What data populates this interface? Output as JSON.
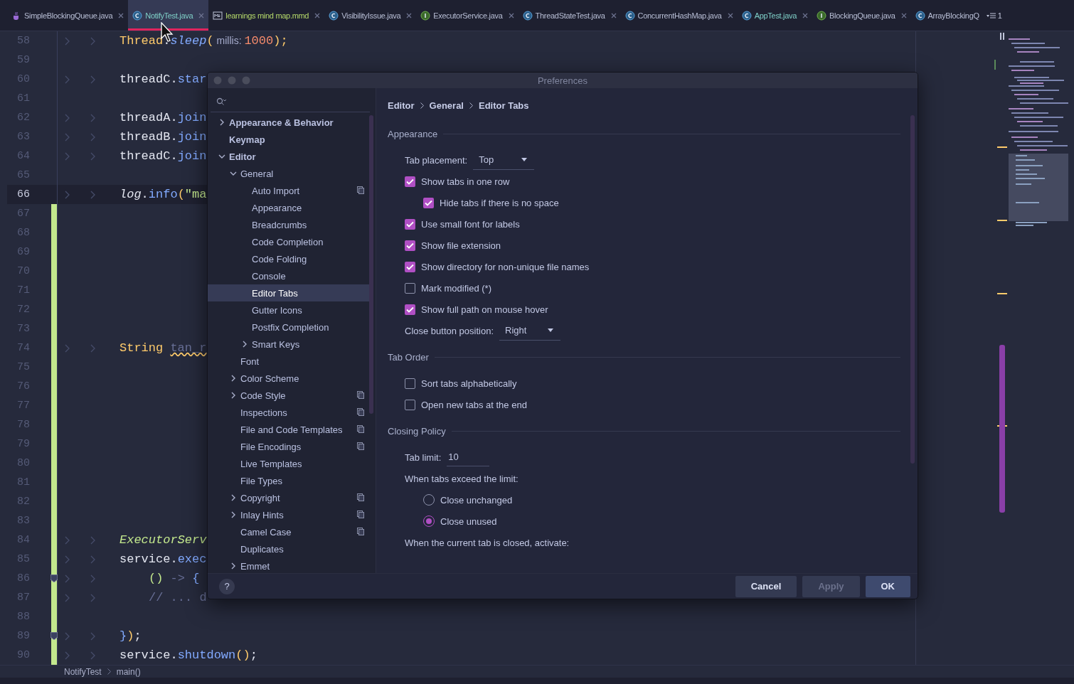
{
  "tabs": [
    {
      "label": "SimpleBlockingQueue.java",
      "kind": "java",
      "color": "#b9bfd6",
      "selected": false
    },
    {
      "label": "NotifyTest.java",
      "kind": "class",
      "color": "#7fd0c8",
      "selected": true
    },
    {
      "label": "learnings mind map.mmd",
      "kind": "markdown",
      "color": "#b5d96a",
      "selected": false
    },
    {
      "label": "VisibilityIssue.java",
      "kind": "class",
      "color": "#b9bfd6",
      "selected": false
    },
    {
      "label": "ExecutorService.java",
      "kind": "interface",
      "color": "#b9bfd6",
      "selected": false
    },
    {
      "label": "ThreadStateTest.java",
      "kind": "class",
      "color": "#b9bfd6",
      "selected": false
    },
    {
      "label": "ConcurrentHashMap.java",
      "kind": "class",
      "color": "#b9bfd6",
      "selected": false
    },
    {
      "label": "AppTest.java",
      "kind": "class",
      "color": "#7fd0c8",
      "selected": false
    },
    {
      "label": "BlockingQueue.java",
      "kind": "interface",
      "color": "#b9bfd6",
      "selected": false
    },
    {
      "label": "ArrayBlockingQ",
      "kind": "class",
      "color": "#b9bfd6",
      "selected": false
    }
  ],
  "tab_overflow_count": "1",
  "code_lines": [
    {
      "number": "58",
      "current": false,
      "changed": false,
      "fold_marker": false,
      "tokens": [
        {
          "text": "Thread",
          "kind": "class"
        },
        {
          "text": ".",
          "kind": "plain"
        },
        {
          "text": "sleep",
          "kind": "static"
        },
        {
          "text": "(",
          "kind": "paren"
        },
        {
          "text": " millis: ",
          "kind": "hint"
        },
        {
          "text": "1000",
          "kind": "number"
        },
        {
          "text": ");",
          "kind": "paren"
        }
      ]
    },
    {
      "number": "59",
      "current": false,
      "changed": false,
      "fold_marker": false
    },
    {
      "number": "60",
      "current": false,
      "changed": false,
      "fold_marker": false,
      "tokens": [
        {
          "text": "threadC",
          "kind": "plain"
        },
        {
          "text": ".",
          "kind": "plain"
        },
        {
          "text": "star",
          "kind": "method"
        }
      ]
    },
    {
      "number": "61",
      "current": false,
      "changed": false,
      "fold_marker": false
    },
    {
      "number": "62",
      "current": false,
      "changed": false,
      "fold_marker": false,
      "tokens": [
        {
          "text": "threadA",
          "kind": "plain"
        },
        {
          "text": ".",
          "kind": "plain"
        },
        {
          "text": "join",
          "kind": "method"
        }
      ]
    },
    {
      "number": "63",
      "current": false,
      "changed": false,
      "fold_marker": false,
      "tokens": [
        {
          "text": "threadB",
          "kind": "plain"
        },
        {
          "text": ".",
          "kind": "plain"
        },
        {
          "text": "join",
          "kind": "method"
        }
      ]
    },
    {
      "number": "64",
      "current": false,
      "changed": false,
      "fold_marker": false,
      "tokens": [
        {
          "text": "threadC",
          "kind": "plain"
        },
        {
          "text": ".",
          "kind": "plain"
        },
        {
          "text": "join",
          "kind": "method"
        }
      ]
    },
    {
      "number": "65",
      "current": false,
      "changed": false,
      "fold_marker": false
    },
    {
      "number": "66",
      "current": true,
      "changed": false,
      "fold_marker": false,
      "tokens": [
        {
          "text": "log",
          "kind": "field"
        },
        {
          "text": ".",
          "kind": "plain"
        },
        {
          "text": "info",
          "kind": "method"
        },
        {
          "text": "(",
          "kind": "paren"
        },
        {
          "text": "\"ma",
          "kind": "string"
        }
      ]
    },
    {
      "number": "67",
      "current": false,
      "changed": true,
      "fold_marker": false
    },
    {
      "number": "68",
      "current": false,
      "changed": true,
      "fold_marker": false
    },
    {
      "number": "69",
      "current": false,
      "changed": true,
      "fold_marker": false
    },
    {
      "number": "70",
      "current": false,
      "changed": true,
      "fold_marker": false
    },
    {
      "number": "71",
      "current": false,
      "changed": true,
      "fold_marker": false
    },
    {
      "number": "72",
      "current": false,
      "changed": true,
      "fold_marker": false
    },
    {
      "number": "73",
      "current": false,
      "changed": true,
      "fold_marker": false
    },
    {
      "number": "74",
      "current": false,
      "changed": true,
      "fold_marker": false,
      "tokens": [
        {
          "text": "String ",
          "kind": "class"
        },
        {
          "text": "tan_r",
          "kind": "unused"
        }
      ]
    },
    {
      "number": "75",
      "current": false,
      "changed": true,
      "fold_marker": false
    },
    {
      "number": "76",
      "current": false,
      "changed": true,
      "fold_marker": false
    },
    {
      "number": "77",
      "current": false,
      "changed": true,
      "fold_marker": false
    },
    {
      "number": "78",
      "current": false,
      "changed": true,
      "fold_marker": false
    },
    {
      "number": "79",
      "current": false,
      "changed": true,
      "fold_marker": false
    },
    {
      "number": "80",
      "current": false,
      "changed": true,
      "fold_marker": false
    },
    {
      "number": "81",
      "current": false,
      "changed": true,
      "fold_marker": false
    },
    {
      "number": "82",
      "current": false,
      "changed": true,
      "fold_marker": false
    },
    {
      "number": "83",
      "current": false,
      "changed": true,
      "fold_marker": false
    },
    {
      "number": "84",
      "current": false,
      "changed": true,
      "fold_marker": false,
      "tokens": [
        {
          "text": "ExecutorServ",
          "kind": "type"
        }
      ]
    },
    {
      "number": "85",
      "current": false,
      "changed": true,
      "fold_marker": false,
      "tokens": [
        {
          "text": "service",
          "kind": "plain"
        },
        {
          "text": ".",
          "kind": "plain"
        },
        {
          "text": "exec",
          "kind": "method"
        }
      ]
    },
    {
      "number": "86",
      "current": false,
      "changed": true,
      "fold_marker": true,
      "tokens": [
        {
          "text": "()",
          "kind": "lambda_indented"
        },
        {
          "text": " -> ",
          "kind": "comment"
        },
        {
          "text": "{",
          "kind": "brace"
        }
      ]
    },
    {
      "number": "87",
      "current": false,
      "changed": true,
      "fold_marker": false,
      "tokens": [
        {
          "text": "// ... d",
          "kind": "comment_indented"
        }
      ]
    },
    {
      "number": "88",
      "current": false,
      "changed": true,
      "fold_marker": false
    },
    {
      "number": "89",
      "current": false,
      "changed": true,
      "fold_marker": true,
      "tokens": [
        {
          "text": "}",
          "kind": "brace"
        },
        {
          "text": ")",
          "kind": "paren"
        },
        {
          "text": ";",
          "kind": "plain"
        }
      ]
    },
    {
      "number": "90",
      "current": false,
      "changed": true,
      "fold_marker": false,
      "tokens": [
        {
          "text": "service",
          "kind": "plain"
        },
        {
          "text": ".",
          "kind": "plain"
        },
        {
          "text": "shutdown",
          "kind": "method"
        },
        {
          "text": "()",
          "kind": "paren"
        },
        {
          "text": ";",
          "kind": "plain"
        }
      ]
    }
  ],
  "breadcrumb": [
    "NotifyTest",
    "main()"
  ],
  "dialog": {
    "title": "Preferences",
    "tree": [
      {
        "label": "Appearance & Behavior",
        "kind": "folder",
        "expanded": false,
        "selected": false,
        "scoped": false
      },
      {
        "label": "Keymap",
        "kind": "page",
        "selected": false,
        "scoped": false
      },
      {
        "label": "Editor",
        "kind": "folder",
        "expanded": true,
        "selected": false,
        "scoped": false,
        "children": [
          {
            "label": "General",
            "kind": "folder",
            "expanded": true,
            "selected": false,
            "scoped": false,
            "children": [
              {
                "label": "Auto Import",
                "kind": "page",
                "selected": false,
                "scoped": true
              },
              {
                "label": "Appearance",
                "kind": "page",
                "selected": false,
                "scoped": false
              },
              {
                "label": "Breadcrumbs",
                "kind": "page",
                "selected": false,
                "scoped": false
              },
              {
                "label": "Code Completion",
                "kind": "page",
                "selected": false,
                "scoped": false
              },
              {
                "label": "Code Folding",
                "kind": "page",
                "selected": false,
                "scoped": false
              },
              {
                "label": "Console",
                "kind": "page",
                "selected": false,
                "scoped": false
              },
              {
                "label": "Editor Tabs",
                "kind": "page",
                "selected": true,
                "scoped": false
              },
              {
                "label": "Gutter Icons",
                "kind": "page",
                "selected": false,
                "scoped": false
              },
              {
                "label": "Postfix Completion",
                "kind": "page",
                "selected": false,
                "scoped": false
              },
              {
                "label": "Smart Keys",
                "kind": "folder",
                "expanded": false,
                "selected": false,
                "scoped": false
              }
            ]
          },
          {
            "label": "Font",
            "kind": "page",
            "selected": false,
            "scoped": false
          },
          {
            "label": "Color Scheme",
            "kind": "folder",
            "expanded": false,
            "selected": false,
            "scoped": false
          },
          {
            "label": "Code Style",
            "kind": "folder",
            "expanded": false,
            "selected": false,
            "scoped": true
          },
          {
            "label": "Inspections",
            "kind": "page",
            "selected": false,
            "scoped": true
          },
          {
            "label": "File and Code Templates",
            "kind": "page",
            "selected": false,
            "scoped": true
          },
          {
            "label": "File Encodings",
            "kind": "page",
            "selected": false,
            "scoped": true
          },
          {
            "label": "Live Templates",
            "kind": "page",
            "selected": false,
            "scoped": false
          },
          {
            "label": "File Types",
            "kind": "page",
            "selected": false,
            "scoped": false
          },
          {
            "label": "Copyright",
            "kind": "folder",
            "expanded": false,
            "selected": false,
            "scoped": true
          },
          {
            "label": "Inlay Hints",
            "kind": "folder",
            "expanded": false,
            "selected": false,
            "scoped": true
          },
          {
            "label": "Camel Case",
            "kind": "page",
            "selected": false,
            "scoped": true
          },
          {
            "label": "Duplicates",
            "kind": "page",
            "selected": false,
            "scoped": false
          },
          {
            "label": "Emmet",
            "kind": "folder",
            "expanded": false,
            "selected": false,
            "scoped": false
          }
        ]
      }
    ],
    "path": [
      "Editor",
      "General",
      "Editor Tabs"
    ],
    "sections": [
      {
        "title": "Appearance",
        "items": [
          {
            "kind": "dropdown",
            "label": "Tab placement:",
            "value": "Top"
          },
          {
            "kind": "checkbox",
            "label": "Show tabs in one row",
            "checked": true,
            "children": [
              {
                "kind": "checkbox",
                "label": "Hide tabs if there is no space",
                "checked": true
              }
            ]
          },
          {
            "kind": "checkbox",
            "label": "Use small font for labels",
            "checked": true
          },
          {
            "kind": "checkbox",
            "label": "Show file extension",
            "checked": true
          },
          {
            "kind": "checkbox",
            "label": "Show directory for non-unique file names",
            "checked": true
          },
          {
            "kind": "checkbox",
            "label": "Mark modified (*)",
            "checked": false
          },
          {
            "kind": "checkbox",
            "label": "Show full path on mouse hover",
            "checked": true
          },
          {
            "kind": "dropdown",
            "label": "Close button position:",
            "value": "Right"
          }
        ]
      },
      {
        "title": "Tab Order",
        "items": [
          {
            "kind": "checkbox",
            "label": "Sort tabs alphabetically",
            "checked": false
          },
          {
            "kind": "checkbox",
            "label": "Open new tabs at the end",
            "checked": false
          }
        ]
      },
      {
        "title": "Closing Policy",
        "items": [
          {
            "kind": "text_field",
            "label": "Tab limit:",
            "value": "10"
          },
          {
            "kind": "text",
            "label": "When tabs exceed the limit:",
            "children": [
              {
                "kind": "radio",
                "label": "Close unchanged",
                "selected": false
              },
              {
                "kind": "radio",
                "label": "Close unused",
                "selected": true
              }
            ]
          },
          {
            "kind": "text",
            "label": "When the current tab is closed, activate:"
          }
        ]
      }
    ],
    "help": "?",
    "buttons": [
      {
        "label": "Cancel",
        "primary": false,
        "disabled": false
      },
      {
        "label": "Apply",
        "primary": false,
        "disabled": true
      },
      {
        "label": "OK",
        "primary": true,
        "disabled": false
      }
    ]
  }
}
